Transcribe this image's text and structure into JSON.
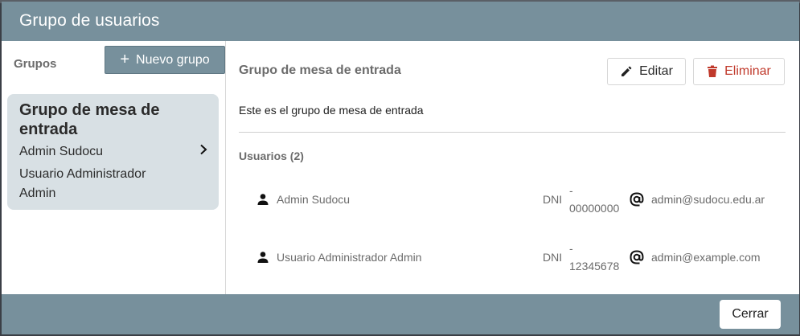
{
  "dialog": {
    "title": "Grupo de usuarios",
    "close_label": "Cerrar"
  },
  "sidebar": {
    "heading": "Grupos",
    "new_group_label": "Nuevo grupo",
    "groups": [
      {
        "title": "Grupo de mesa de entrada",
        "members": [
          "Admin Sudocu",
          "Usuario Administrador Admin"
        ],
        "selected": true
      }
    ]
  },
  "detail": {
    "title": "Grupo de mesa de entrada",
    "edit_label": "Editar",
    "delete_label": "Eliminar",
    "description": "Este es el grupo de mesa de entrada",
    "users_heading": "Usuarios (2)",
    "users": [
      {
        "name": "Admin Sudocu",
        "dni_label": "DNI",
        "dni_value": "- 00000000",
        "email": "admin@sudocu.edu.ar"
      },
      {
        "name": "Usuario Administrador Admin",
        "dni_label": "DNI",
        "dni_value": "- 12345678",
        "email": "admin@example.com"
      }
    ]
  },
  "colors": {
    "header": "#77909c",
    "selected_card": "#d8e0e4",
    "danger": "#c0392b"
  },
  "icons": {
    "add": "plus-icon",
    "edit": "pencil-icon",
    "delete": "trash-icon",
    "user": "person-icon",
    "email": "at-sign-icon",
    "chevron": "chevron-right-icon"
  }
}
